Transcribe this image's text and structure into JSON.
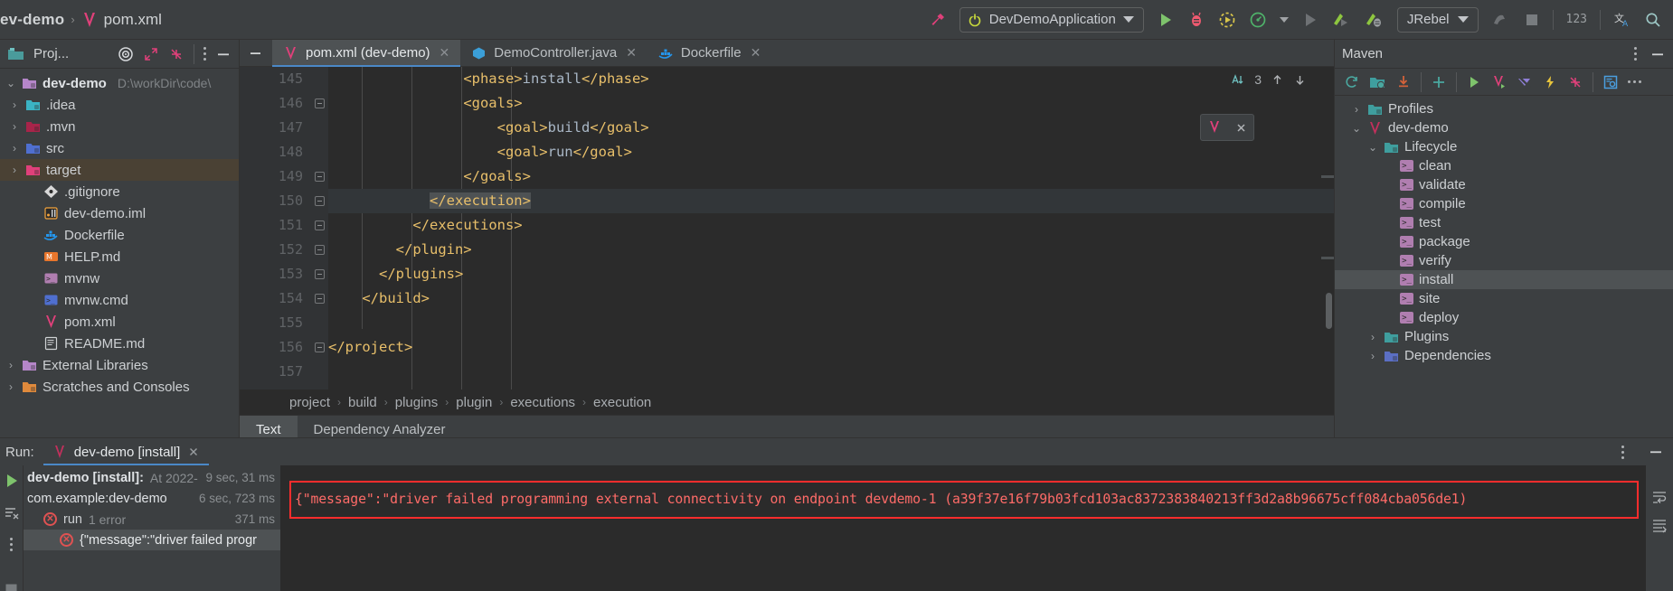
{
  "toolbar": {
    "breadcrumb_project": "ev-demo",
    "breadcrumb_sep": "›",
    "breadcrumb_file": "pom.xml",
    "build_icon": "hammer-icon",
    "run_config": "DevDemoApplication",
    "run_icon": "run-icon",
    "debug_icon": "debug-icon",
    "run_with_coverage_icon": "run-coverage-icon",
    "profiler_icon": "profiler-icon",
    "more_run_icon": "chevron-down-icon",
    "stop_icon": "stop-run-icon",
    "jrebel_run_icon": "jrebel-run-icon",
    "jrebel_debug_icon": "jrebel-debug-icon",
    "jrebel_label": "JRebel",
    "build_project_icon": "build-project-icon",
    "stop_square_icon": "stop-icon",
    "numeric_icon": "123",
    "translate_icon": "translate-icon",
    "search_icon": "search-icon"
  },
  "project_panel": {
    "title": "Proj...",
    "icons": {
      "project_icon": "project-folder-icon",
      "target_icon": "locate-target-icon",
      "expand_icon": "expand-all-icon",
      "collapse_icon": "collapse-all-icon",
      "options_icon": "more-options-icon",
      "minimize_icon": "minimize-icon"
    },
    "tree": [
      {
        "label": "dev-demo",
        "sub": "D:\\workDir\\code\\",
        "arrow": "v",
        "bold": true,
        "indent": 0,
        "icon": "module-folder-icon",
        "color": "#b586c9",
        "selected": false
      },
      {
        "label": ".idea",
        "sub": "",
        "arrow": ">",
        "bold": false,
        "indent": 1,
        "icon": "idea-folder-icon",
        "color": "#3bb3c4",
        "selected": false
      },
      {
        "label": ".mvn",
        "sub": "",
        "arrow": ">",
        "bold": false,
        "indent": 1,
        "icon": "maven-folder-icon",
        "color": "#a8244a",
        "selected": false
      },
      {
        "label": "src",
        "sub": "",
        "arrow": ">",
        "bold": false,
        "indent": 1,
        "icon": "source-folder-icon",
        "color": "#4f6fd0",
        "selected": false
      },
      {
        "label": "target",
        "sub": "",
        "arrow": ">",
        "bold": false,
        "indent": 1,
        "icon": "target-folder-icon",
        "color": "#e0407a",
        "selected": true
      },
      {
        "label": ".gitignore",
        "sub": "",
        "arrow": "",
        "bold": false,
        "indent": 2,
        "icon": "git-file-icon",
        "color": "#d8d8d8",
        "selected": false
      },
      {
        "label": "dev-demo.iml",
        "sub": "",
        "arrow": "",
        "bold": false,
        "indent": 2,
        "icon": "iml-file-icon",
        "color": "#f2a33c",
        "selected": false
      },
      {
        "label": "Dockerfile",
        "sub": "",
        "arrow": "",
        "bold": false,
        "indent": 2,
        "icon": "docker-file-icon",
        "color": "#2496ed",
        "selected": false
      },
      {
        "label": "HELP.md",
        "sub": "",
        "arrow": "",
        "bold": false,
        "indent": 2,
        "icon": "markdown-file-icon",
        "color": "#e8762c",
        "selected": false
      },
      {
        "label": "mvnw",
        "sub": "",
        "arrow": "",
        "bold": false,
        "indent": 2,
        "icon": "shell-file-icon",
        "color": "#b07eb0",
        "selected": false
      },
      {
        "label": "mvnw.cmd",
        "sub": "",
        "arrow": "",
        "bold": false,
        "indent": 2,
        "icon": "cmd-file-icon",
        "color": "#4f6fd0",
        "selected": false
      },
      {
        "label": "pom.xml",
        "sub": "",
        "arrow": "",
        "bold": false,
        "indent": 2,
        "icon": "maven-pom-icon",
        "color": "#e0407a",
        "selected": false
      },
      {
        "label": "README.md",
        "sub": "",
        "arrow": "",
        "bold": false,
        "indent": 2,
        "icon": "readme-file-icon",
        "color": "#cfd2d4",
        "selected": false
      },
      {
        "label": "External Libraries",
        "sub": "",
        "arrow": ">",
        "bold": false,
        "indent": 0,
        "icon": "libraries-icon",
        "color": "#b586c9",
        "selected": false
      },
      {
        "label": "Scratches and Consoles",
        "sub": "",
        "arrow": ">",
        "bold": false,
        "indent": 0,
        "icon": "scratches-icon",
        "color": "#e08a3c",
        "selected": false
      }
    ]
  },
  "editor": {
    "tabs": [
      {
        "label": "pom.xml (dev-demo)",
        "icon": "maven-pom-icon",
        "color": "#e0407a",
        "active": true,
        "closable": true
      },
      {
        "label": "DemoController.java",
        "icon": "java-class-icon",
        "color": "#3b9fd8",
        "active": false,
        "closable": true
      },
      {
        "label": "Dockerfile",
        "icon": "docker-file-icon",
        "color": "#2496ed",
        "active": false,
        "closable": true
      }
    ],
    "inspection_count": "3",
    "inspection_icon": "inspection-icon",
    "prev_error_icon": "previous-occurrence-icon",
    "next_error_icon": "next-occurrence-icon",
    "float_maven_icon": "maven-reload-icon",
    "float_close_icon": "close-icon",
    "lines": [
      {
        "num": "145",
        "fold": false,
        "highlight": false,
        "segments": [
          {
            "t": "                ",
            "c": "tx"
          },
          {
            "t": "<phase>",
            "c": "tg"
          },
          {
            "t": "install",
            "c": "tx"
          },
          {
            "t": "</phase>",
            "c": "tg"
          }
        ]
      },
      {
        "num": "146",
        "fold": true,
        "highlight": false,
        "segments": [
          {
            "t": "                ",
            "c": "tx"
          },
          {
            "t": "<goals>",
            "c": "tg"
          }
        ]
      },
      {
        "num": "147",
        "fold": false,
        "highlight": false,
        "segments": [
          {
            "t": "                    ",
            "c": "tx"
          },
          {
            "t": "<goal>",
            "c": "tg"
          },
          {
            "t": "build",
            "c": "tx"
          },
          {
            "t": "</goal>",
            "c": "tg"
          }
        ]
      },
      {
        "num": "148",
        "fold": false,
        "highlight": false,
        "segments": [
          {
            "t": "                    ",
            "c": "tx"
          },
          {
            "t": "<goal>",
            "c": "tg"
          },
          {
            "t": "run",
            "c": "tx"
          },
          {
            "t": "</goal>",
            "c": "tg"
          }
        ]
      },
      {
        "num": "149",
        "fold": true,
        "highlight": false,
        "segments": [
          {
            "t": "                ",
            "c": "tx"
          },
          {
            "t": "</goals>",
            "c": "tg"
          }
        ]
      },
      {
        "num": "150",
        "fold": true,
        "highlight": true,
        "segments": [
          {
            "t": "            ",
            "c": "tx"
          },
          {
            "t": "</execution>",
            "c": "tg sel-tok"
          }
        ]
      },
      {
        "num": "151",
        "fold": true,
        "highlight": false,
        "segments": [
          {
            "t": "          ",
            "c": "tx"
          },
          {
            "t": "</executions>",
            "c": "tg"
          }
        ]
      },
      {
        "num": "152",
        "fold": true,
        "highlight": false,
        "segments": [
          {
            "t": "        ",
            "c": "tx"
          },
          {
            "t": "</plugin>",
            "c": "tg"
          }
        ]
      },
      {
        "num": "153",
        "fold": true,
        "highlight": false,
        "segments": [
          {
            "t": "      ",
            "c": "tx"
          },
          {
            "t": "</plugins>",
            "c": "tg"
          }
        ]
      },
      {
        "num": "154",
        "fold": true,
        "highlight": false,
        "segments": [
          {
            "t": "    ",
            "c": "tx"
          },
          {
            "t": "</build>",
            "c": "tg"
          }
        ]
      },
      {
        "num": "155",
        "fold": false,
        "highlight": false,
        "segments": [
          {
            "t": "",
            "c": "tx"
          }
        ]
      },
      {
        "num": "156",
        "fold": true,
        "highlight": false,
        "segments": [
          {
            "t": "",
            "c": "tx"
          },
          {
            "t": "</project>",
            "c": "tg"
          }
        ]
      },
      {
        "num": "157",
        "fold": false,
        "highlight": false,
        "segments": [
          {
            "t": "",
            "c": "tx"
          }
        ]
      }
    ],
    "breadcrumb": [
      "project",
      "build",
      "plugins",
      "plugin",
      "executions",
      "execution"
    ],
    "bottom_tabs": [
      {
        "label": "Text",
        "active": true
      },
      {
        "label": "Dependency Analyzer",
        "active": false
      }
    ]
  },
  "maven_panel": {
    "title": "Maven",
    "options_icon": "more-options-icon",
    "minimize_icon": "minimize-icon",
    "toolbar_icons": [
      "reload-all-projects-icon",
      "add-maven-project-icon",
      "download-sources-icon",
      "add-icon",
      "run-icon",
      "execute-maven-goal-icon",
      "toggle-offline-icon",
      "toggle-skip-tests-icon",
      "collapse-all-icon",
      "show-diagram-icon",
      "more-icon"
    ],
    "tree": [
      {
        "label": "Profiles",
        "arrow": ">",
        "indent": 1,
        "icon": "profiles-folder-icon",
        "selected": false
      },
      {
        "label": "dev-demo",
        "arrow": "v",
        "indent": 1,
        "icon": "maven-project-icon",
        "selected": false
      },
      {
        "label": "Lifecycle",
        "arrow": "v",
        "indent": 2,
        "icon": "lifecycle-folder-icon",
        "selected": false
      },
      {
        "label": "clean",
        "arrow": "",
        "indent": 3,
        "icon": "maven-goal-icon",
        "selected": false
      },
      {
        "label": "validate",
        "arrow": "",
        "indent": 3,
        "icon": "maven-goal-icon",
        "selected": false
      },
      {
        "label": "compile",
        "arrow": "",
        "indent": 3,
        "icon": "maven-goal-icon",
        "selected": false
      },
      {
        "label": "test",
        "arrow": "",
        "indent": 3,
        "icon": "maven-goal-icon",
        "selected": false
      },
      {
        "label": "package",
        "arrow": "",
        "indent": 3,
        "icon": "maven-goal-icon",
        "selected": false
      },
      {
        "label": "verify",
        "arrow": "",
        "indent": 3,
        "icon": "maven-goal-icon",
        "selected": false
      },
      {
        "label": "install",
        "arrow": "",
        "indent": 3,
        "icon": "maven-goal-icon",
        "selected": true
      },
      {
        "label": "site",
        "arrow": "",
        "indent": 3,
        "icon": "maven-goal-icon",
        "selected": false
      },
      {
        "label": "deploy",
        "arrow": "",
        "indent": 3,
        "icon": "maven-goal-icon",
        "selected": false
      },
      {
        "label": "Plugins",
        "arrow": ">",
        "indent": 2,
        "icon": "plugins-folder-icon",
        "selected": false
      },
      {
        "label": "Dependencies",
        "arrow": ">",
        "indent": 2,
        "icon": "dependencies-folder-icon",
        "selected": false
      }
    ]
  },
  "run_panel": {
    "label": "Run:",
    "tab_label": "dev-demo [install]",
    "tab_icon": "maven-pom-icon",
    "close_icon": "close-icon",
    "sidebar_icons": [
      "rerun-icon",
      "clear-all-icon",
      "more-options-icon",
      "stop-icon"
    ],
    "tree": [
      {
        "title": "dev-demo [install]:",
        "detail": "At 2022-",
        "time": "9 sec, 31 ms",
        "indent": 0,
        "status": "none",
        "selected": false
      },
      {
        "title": "com.example:dev-demo",
        "detail": "",
        "time": "6 sec, 723 ms",
        "indent": 0,
        "status": "none",
        "selected": false
      },
      {
        "title": "run",
        "detail": "1 error",
        "time": "371 ms",
        "indent": 1,
        "status": "error",
        "selected": false
      },
      {
        "title": "{\"message\":\"driver failed progr",
        "detail": "",
        "time": "",
        "indent": 2,
        "status": "error",
        "selected": true
      }
    ],
    "console_error": "{\"message\":\"driver failed programming external connectivity on endpoint devdemo-1 (a39f37e16f79b03fcd103ac8372383840213ff3d2a8b96675cff084cba056de1)",
    "console_side_icons": [
      "soft-wrap-icon",
      "scroll-to-end-icon"
    ]
  },
  "colors": {
    "accent_blue": "#4a88c7",
    "error_red": "#ff2d2d",
    "error_text": "#ff6b68",
    "maven_pink": "#e0407a",
    "panel_bg": "#3c3f41",
    "editor_bg": "#2b2b2b",
    "selection": "#4e5254"
  }
}
